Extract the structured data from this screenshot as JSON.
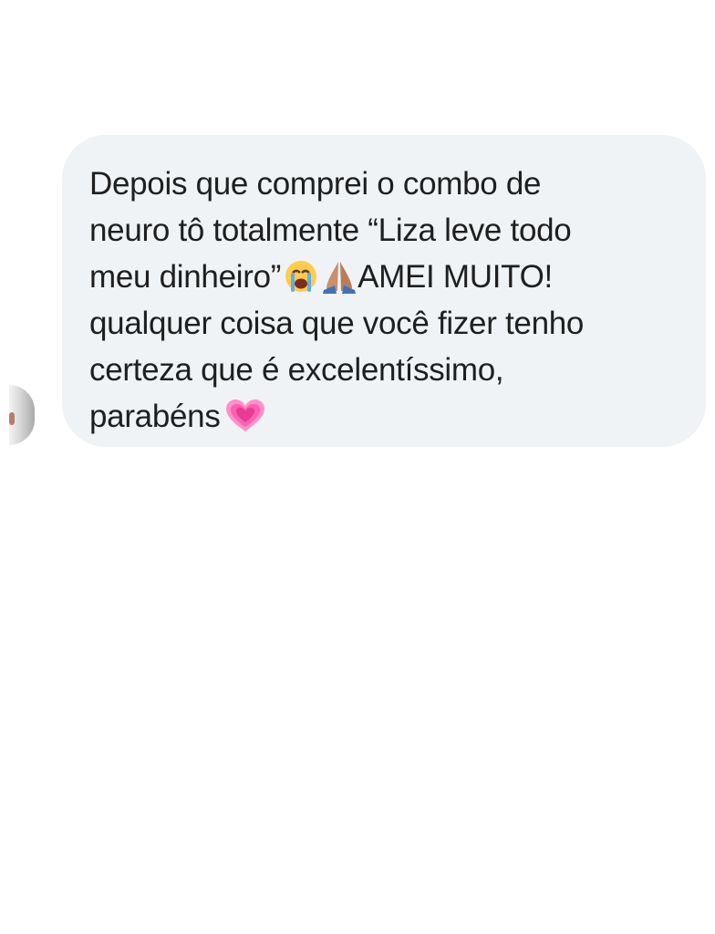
{
  "conversation": {
    "message": {
      "line1": "Depois que comprei o combo de",
      "line2": "neuro tô totalmente “Liza leve todo",
      "line3_before": "meu dinheiro”",
      "line3_after": "AMEI MUITO!",
      "line4": "qualquer coisa que você fizer tenho",
      "line5": "certeza que é excelentíssimo,",
      "line6": "parabéns",
      "emojis": [
        "loudly-crying-face-emoji",
        "folded-hands-emoji",
        "growing-heart-emoji"
      ]
    },
    "colors": {
      "bubble_background": "#eff3f6",
      "text": "#1f1f1f"
    }
  }
}
